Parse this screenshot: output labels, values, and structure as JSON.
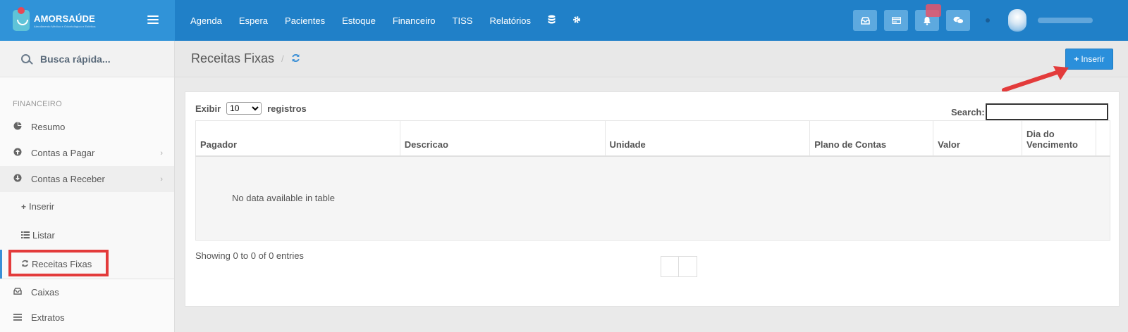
{
  "brand": {
    "name": "AMORSAÚDE",
    "tagline": "Atendimento Médico e Odontológico e Estética"
  },
  "topnav": {
    "items": [
      {
        "label": "Agenda"
      },
      {
        "label": "Espera"
      },
      {
        "label": "Pacientes"
      },
      {
        "label": "Estoque"
      },
      {
        "label": "Financeiro"
      },
      {
        "label": "TISS"
      },
      {
        "label": "Relatórios"
      }
    ],
    "icons": [
      "database-icon",
      "gear-icon"
    ],
    "right_buttons": [
      "inbox-icon",
      "card-icon",
      "bell-icon",
      "chat-icon"
    ]
  },
  "sidebar": {
    "search_placeholder": "Busca rápida...",
    "section": "FINANCEIRO",
    "items": [
      {
        "label": "Resumo",
        "icon": "pie-chart-icon"
      },
      {
        "label": "Contas a Pagar",
        "icon": "arrow-circle-up-icon"
      },
      {
        "label": "Contas a Receber",
        "icon": "arrow-circle-down-icon"
      }
    ],
    "subitems": [
      {
        "label": "Inserir",
        "icon": "plus-icon"
      },
      {
        "label": "Listar",
        "icon": "list-icon"
      },
      {
        "label": "Receitas Fixas",
        "icon": "refresh-icon"
      }
    ],
    "bottom_items": [
      {
        "label": "Caixas",
        "icon": "inbox-icon"
      },
      {
        "label": "Extratos",
        "icon": "bars-icon"
      }
    ]
  },
  "page": {
    "title": "Receitas Fixas",
    "breadcrumb_sep": "/",
    "insert_label": "Inserir"
  },
  "table": {
    "length_label_before": "Exibir",
    "length_value": "10",
    "length_label_after": "registros",
    "search_label": "Search:",
    "columns": [
      "Pagador",
      "Descricao",
      "Unidade",
      "Plano de Contas",
      "Valor",
      "Dia do Vencimento"
    ],
    "empty_text": "No data available in table",
    "info": "Showing 0 to 0 of 0 entries"
  },
  "colors": {
    "topbar": "#2080c8",
    "accent": "#2a8fdb",
    "highlight": "#e33b3b"
  }
}
